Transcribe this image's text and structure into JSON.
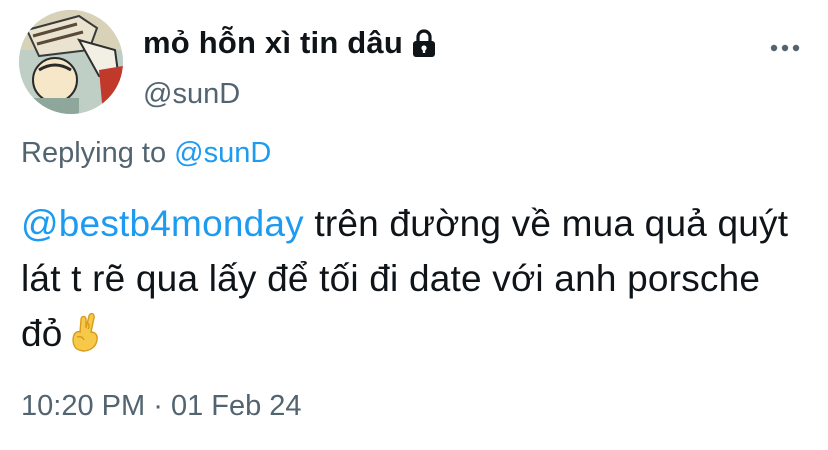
{
  "author": {
    "display_name": "mỏ hỗn xì tin dâu",
    "handle": "@sunD",
    "protected_icon": "lock-icon",
    "avatar": "avatar-image"
  },
  "menu_icon": "more-horizontal-icon",
  "reply": {
    "prefix": "Replying to",
    "handle": "@sunD"
  },
  "tweet": {
    "mention": "@bestb4monday",
    "body": "trên đường về mua quả quýt lát t rẽ qua lấy để tối đi date với anh porsche đỏ",
    "emoji": "crossed-fingers-emoji"
  },
  "meta": {
    "time": "10:20 PM",
    "separator": "·",
    "date": "01 Feb 24"
  },
  "colors": {
    "link": "#1d9bf0",
    "secondary": "#536471",
    "primary_text": "#0f1419"
  }
}
